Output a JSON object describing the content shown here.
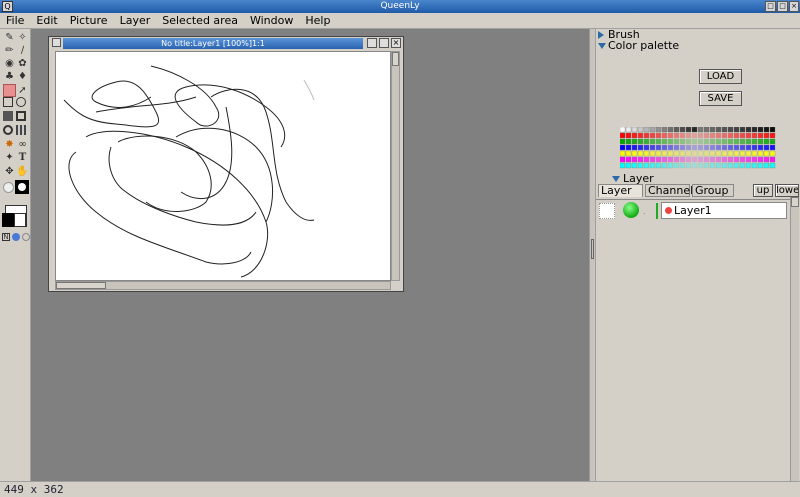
{
  "app": {
    "title": "QueenLy"
  },
  "menu": [
    "File",
    "Edit",
    "Picture",
    "Layer",
    "Selected area",
    "Window",
    "Help"
  ],
  "document": {
    "title": "No title:Layer1 [100%]1:1"
  },
  "panels": {
    "brush": "Brush",
    "color_palette": "Color palette",
    "load": "LOAD",
    "save": "SAVE",
    "layer_header": "Layer",
    "tabs": [
      "Layer",
      "Channel",
      "Group"
    ],
    "up": "up",
    "down": "lower",
    "layer_name": "Layer1"
  },
  "status": {
    "size": "449 x 362"
  },
  "colors": {
    "titlebar": "#2f6fbf",
    "panel": "#d4d0c8",
    "workspace": "#808080"
  }
}
